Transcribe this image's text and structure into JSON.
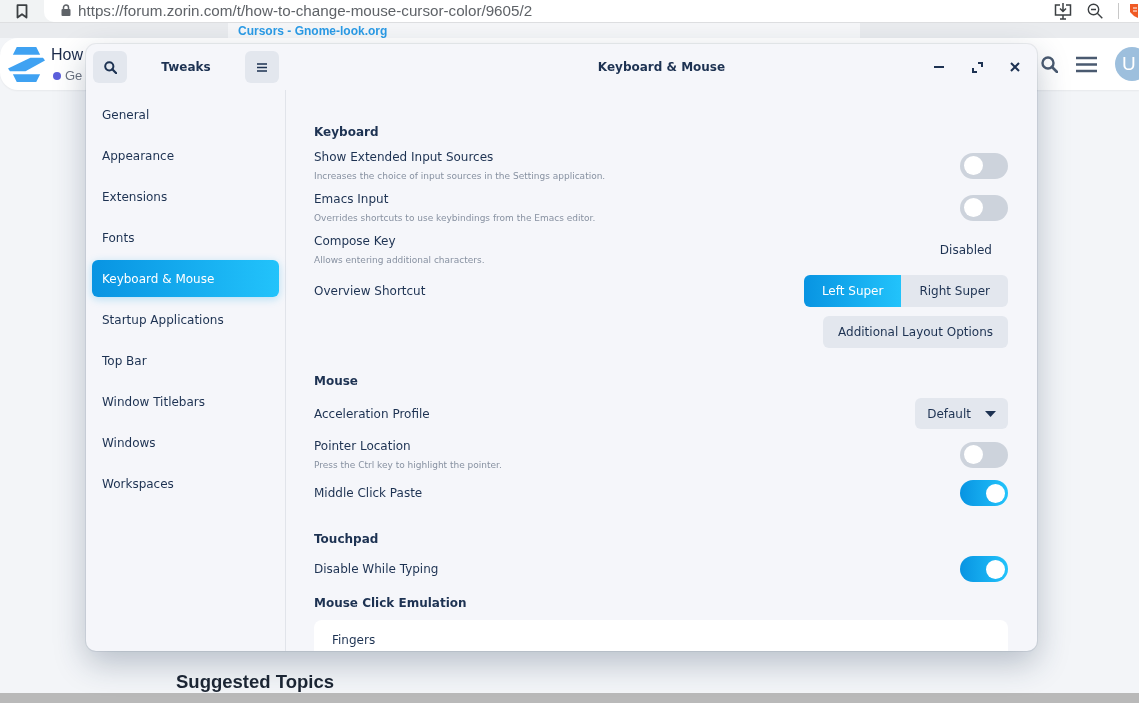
{
  "browser": {
    "url": "https://forum.zorin.com/t/how-to-change-mouse-cursor-color/9605/2"
  },
  "page": {
    "banner_link": "Cursors - Gnome-look.org",
    "topic_title": "How",
    "category": "Ge",
    "avatar_letter": "U",
    "section_heading": "Suggested Topics"
  },
  "window": {
    "app_title": "Tweaks",
    "title": "Keyboard & Mouse",
    "sidebar": {
      "items": [
        {
          "label": "General",
          "selected": false
        },
        {
          "label": "Appearance",
          "selected": false
        },
        {
          "label": "Extensions",
          "selected": false
        },
        {
          "label": "Fonts",
          "selected": false
        },
        {
          "label": "Keyboard & Mouse",
          "selected": true
        },
        {
          "label": "Startup Applications",
          "selected": false
        },
        {
          "label": "Top Bar",
          "selected": false
        },
        {
          "label": "Window Titlebars",
          "selected": false
        },
        {
          "label": "Windows",
          "selected": false
        },
        {
          "label": "Workspaces",
          "selected": false
        }
      ]
    },
    "sections": [
      {
        "heading": "Keyboard",
        "rows": [
          {
            "kind": "switch",
            "label": "Show Extended Input Sources",
            "description": "Increases the choice of input sources in the Settings application.",
            "on": false
          },
          {
            "kind": "switch",
            "label": "Emacs Input",
            "description": "Overrides shortcuts to use keybindings from the Emacs editor.",
            "on": false
          },
          {
            "kind": "value",
            "label": "Compose Key",
            "description": "Allows entering additional characters.",
            "value": "Disabled"
          },
          {
            "kind": "segmented",
            "label": "Overview Shortcut",
            "options": [
              {
                "label": "Left Super",
                "selected": true
              },
              {
                "label": "Right Super",
                "selected": false
              }
            ]
          },
          {
            "kind": "button",
            "label": "Additional Layout Options"
          }
        ]
      },
      {
        "heading": "Mouse",
        "rows": [
          {
            "kind": "dropdown",
            "label": "Acceleration Profile",
            "value": "Default"
          },
          {
            "kind": "switch",
            "label": "Pointer Location",
            "description": "Press the Ctrl key to highlight the pointer.",
            "on": false
          },
          {
            "kind": "switch",
            "label": "Middle Click Paste",
            "on": true
          }
        ]
      },
      {
        "heading": "Touchpad",
        "rows": [
          {
            "kind": "switch",
            "label": "Disable While Typing",
            "on": true
          },
          {
            "kind": "subheading",
            "label": "Mouse Click Emulation"
          },
          {
            "kind": "card",
            "label": "Fingers"
          }
        ]
      }
    ]
  }
}
